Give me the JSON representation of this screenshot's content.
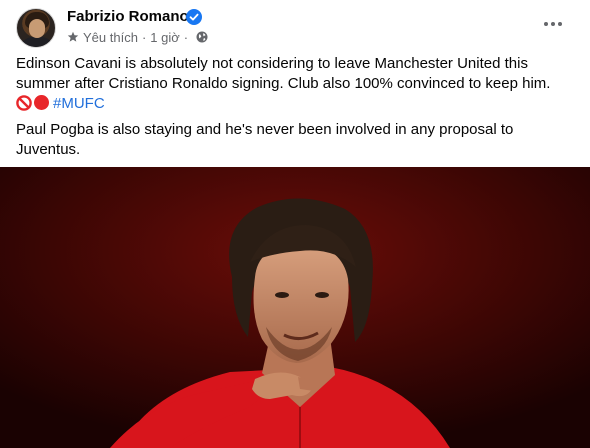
{
  "post": {
    "author_name": "Fabrizio Romano",
    "meta": {
      "follow_label": "Yêu thích",
      "separator": "·",
      "time": "1 giờ",
      "separator2": "·"
    },
    "paragraph1": "Edinson Cavani is absolutely not considering to leave Manchester United this summer after Cristiano Ronaldo signing. Club also 100% convinced to keep him.",
    "hashtag": "#MUFC",
    "paragraph2": "Paul Pogba is also staying and he's never been involved in any proposal to Juventus."
  },
  "icons": {
    "verified": "verified-badge-icon",
    "star": "star-icon",
    "globe": "globe-icon",
    "more": "more-horizontal-icon",
    "emoji1": "no-entry-emoji",
    "emoji2": "red-circle-emoji"
  },
  "colors": {
    "name": "#050505",
    "meta": "#65676b",
    "hashtag": "#216fdb",
    "verified": "#1877f2",
    "photo_bg": "#3a0503"
  }
}
